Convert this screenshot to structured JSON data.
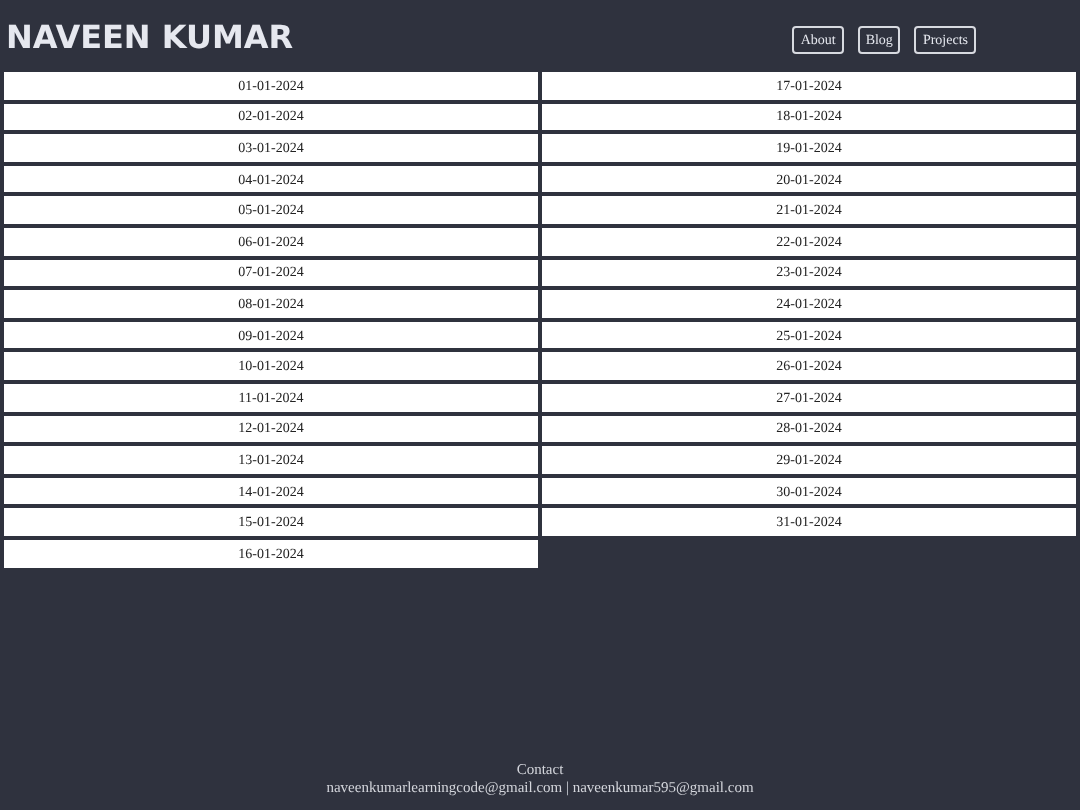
{
  "header": {
    "title": "NAVEEN KUMAR",
    "nav": [
      "About",
      "Blog",
      "Projects"
    ]
  },
  "dates": [
    "01-01-2024",
    "02-01-2024",
    "03-01-2024",
    "04-01-2024",
    "05-01-2024",
    "06-01-2024",
    "07-01-2024",
    "08-01-2024",
    "09-01-2024",
    "10-01-2024",
    "11-01-2024",
    "12-01-2024",
    "13-01-2024",
    "14-01-2024",
    "15-01-2024",
    "16-01-2024",
    "17-01-2024",
    "18-01-2024",
    "19-01-2024",
    "20-01-2024",
    "21-01-2024",
    "22-01-2024",
    "23-01-2024",
    "24-01-2024",
    "25-01-2024",
    "26-01-2024",
    "27-01-2024",
    "28-01-2024",
    "29-01-2024",
    "30-01-2024",
    "31-01-2024"
  ],
  "footer": {
    "heading": "Contact",
    "emails": "naveenkumarlearningcode@gmail.com | naveenkumar595@gmail.com"
  }
}
